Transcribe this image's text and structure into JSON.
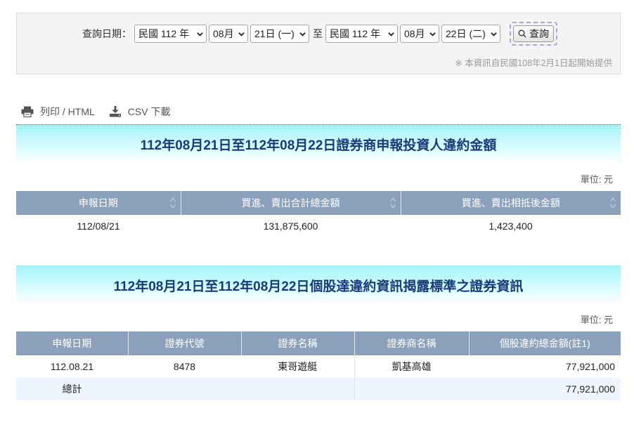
{
  "query": {
    "label": "查詢日期：",
    "start": {
      "year": "民國 112 年",
      "month": "08月",
      "day": "21日 (一)"
    },
    "to_label": "至",
    "end": {
      "year": "民國 112 年",
      "month": "08月",
      "day": "22日 (二)"
    },
    "button_label": "查詢",
    "note": "※ 本資訊自民國108年2月1日起開始提供"
  },
  "toolbar": {
    "print_label": "列印 / HTML",
    "csv_label": "CSV 下載"
  },
  "section1": {
    "title_bold": "112年08月21日至112年08月22日",
    "title_rest": " 證券商申報投資人違約金額",
    "unit": "單位: 元",
    "columns": [
      "申報日期",
      "買進、賣出合計總金額",
      "買進、賣出相抵後金額"
    ],
    "rows": [
      [
        "112/08/21",
        "131,875,600",
        "1,423,400"
      ]
    ]
  },
  "section2": {
    "title_bold": "112年08月21日至112年08月22日",
    "title_rest": " 個股達違約資訊揭露標準之證券資訊",
    "unit": "單位: 元",
    "columns": [
      "申報日期",
      "證券代號",
      "證券名稱",
      "證券商名稱",
      "個股違約總金額(註1)"
    ],
    "rows": [
      [
        "112.08.21",
        "8478",
        "東哥遊艇",
        "凱基高雄",
        "77,921,000"
      ]
    ],
    "total": {
      "label": "總計",
      "amount": "77,921,000"
    }
  }
}
